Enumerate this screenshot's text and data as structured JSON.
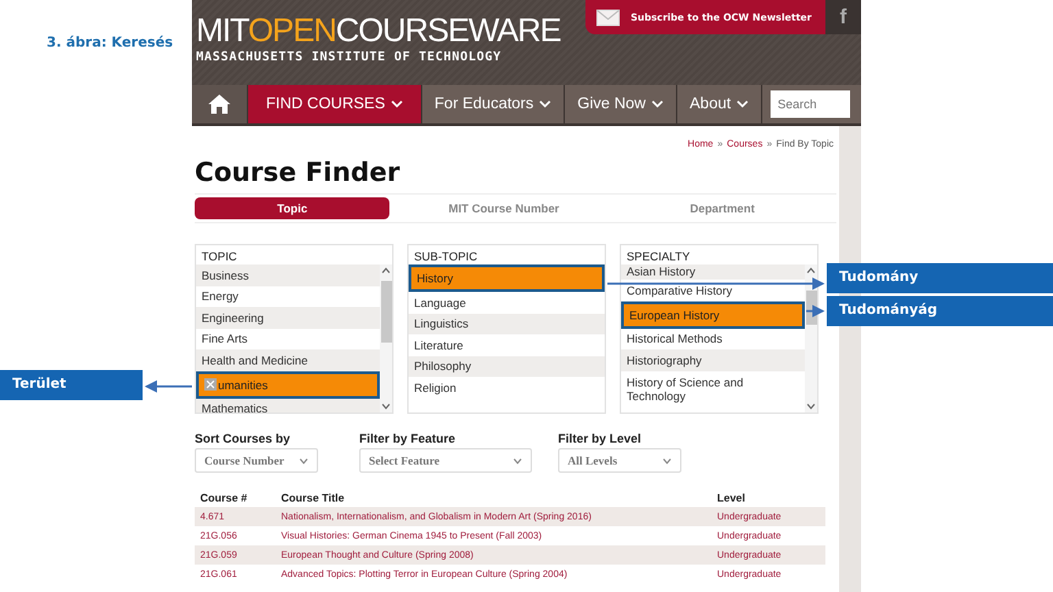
{
  "caption": "3. ábra: Keresés",
  "header": {
    "logo": {
      "mit": "MIT",
      "open": "OPEN",
      "courseware": "COURSEWARE",
      "subtitle": "MASSACHUSETTS INSTITUTE OF TECHNOLOGY"
    },
    "newsletter": "Subscribe to the OCW Newsletter",
    "social": "f"
  },
  "nav": {
    "items": [
      {
        "label": "FIND COURSES",
        "selected": true
      },
      {
        "label": "For Educators",
        "selected": false
      },
      {
        "label": "Give Now",
        "selected": false
      },
      {
        "label": "About",
        "selected": false
      }
    ],
    "search": {
      "placeholder": "Search"
    }
  },
  "breadcrumb": {
    "separator": "»",
    "items": [
      {
        "label": "Home",
        "current": false
      },
      {
        "label": "Courses",
        "current": false
      },
      {
        "label": "Find By Topic",
        "current": true
      }
    ]
  },
  "title": "Course Finder",
  "tabs": [
    {
      "label": "Topic",
      "selected": true
    },
    {
      "label": "MIT Course Number",
      "selected": false
    },
    {
      "label": "Department",
      "selected": false
    }
  ],
  "lists": [
    {
      "heading": "TOPIC",
      "items": [
        {
          "label": "Business",
          "selected": false
        },
        {
          "label": "Energy",
          "selected": false
        },
        {
          "label": "Engineering",
          "selected": false
        },
        {
          "label": "Fine Arts",
          "selected": false
        },
        {
          "label": "Health and Medicine",
          "selected": false
        },
        {
          "label": "umanities",
          "selected": true
        },
        {
          "label": "Mathematics",
          "selected": false
        }
      ]
    },
    {
      "heading": "SUB-TOPIC",
      "items": [
        {
          "label": "History",
          "selected": true
        },
        {
          "label": "Language",
          "selected": false
        },
        {
          "label": "Linguistics",
          "selected": false
        },
        {
          "label": "Literature",
          "selected": false
        },
        {
          "label": "Philosophy",
          "selected": false
        },
        {
          "label": "Religion",
          "selected": false
        }
      ]
    },
    {
      "heading": "SPECIALTY",
      "items": [
        {
          "label": "Asian History",
          "selected": false
        },
        {
          "label": "Comparative History",
          "selected": false
        },
        {
          "label": "European History",
          "selected": true
        },
        {
          "label": "Historical Methods",
          "selected": false
        },
        {
          "label": "Historiography",
          "selected": false
        },
        {
          "label": "History of Science and Technology",
          "selected": false
        }
      ]
    }
  ],
  "filters": [
    {
      "label": "Sort Courses by",
      "value": "Course Number"
    },
    {
      "label": "Filter by Feature",
      "value": "Select Feature"
    },
    {
      "label": "Filter by Level",
      "value": "All Levels"
    }
  ],
  "table": {
    "columns": [
      "Course #",
      "Course Title",
      "Level"
    ],
    "rows": [
      [
        "4.671",
        "Nationalism, Internationalism, and Globalism in Modern Art (Spring 2016)",
        "Undergraduate"
      ],
      [
        "21G.056",
        "Visual Histories: German Cinema 1945 to Present (Fall 2003)",
        "Undergraduate"
      ],
      [
        "21G.059",
        "European Thought and Culture (Spring 2008)",
        "Undergraduate"
      ],
      [
        "21G.061",
        "Advanced Topics: Plotting Terror in European Culture (Spring 2004)",
        "Undergraduate"
      ]
    ]
  },
  "callouts": [
    {
      "label": "Tudomány"
    },
    {
      "label": "Tudományág"
    },
    {
      "label": "Terület"
    }
  ]
}
